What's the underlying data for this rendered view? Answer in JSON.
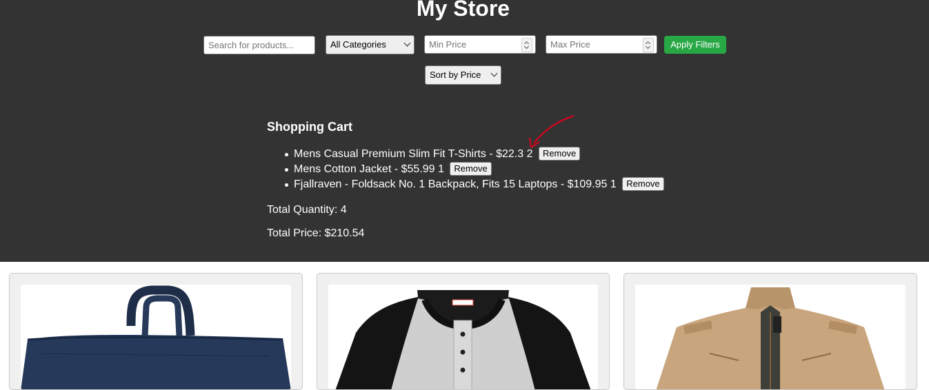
{
  "store": {
    "title": "My Store"
  },
  "filters": {
    "search_placeholder": "Search for products...",
    "category_selected": "All Categories",
    "min_price_placeholder": "Min Price",
    "max_price_placeholder": "Max Price",
    "apply_label": "Apply Filters",
    "sort_selected": "Sort by Price"
  },
  "cart": {
    "title": "Shopping Cart",
    "items": [
      {
        "text": "Mens Casual Premium Slim Fit T-Shirts - $22.3 2",
        "remove_label": "Remove"
      },
      {
        "text": "Mens Cotton Jacket - $55.99 1",
        "remove_label": "Remove"
      },
      {
        "text": "Fjallraven - Foldsack No. 1 Backpack, Fits 15 Laptops - $109.95 1",
        "remove_label": "Remove"
      }
    ],
    "total_quantity": "Total Quantity: 4",
    "total_price": "Total Price: $210.54"
  },
  "products": [
    {
      "image_icon": "backpack-image"
    },
    {
      "image_icon": "raglan-shirt-image"
    },
    {
      "image_icon": "jacket-image"
    }
  ],
  "colors": {
    "header_bg": "#333333",
    "apply_button": "#28a745",
    "annotation": "#e0001b"
  }
}
